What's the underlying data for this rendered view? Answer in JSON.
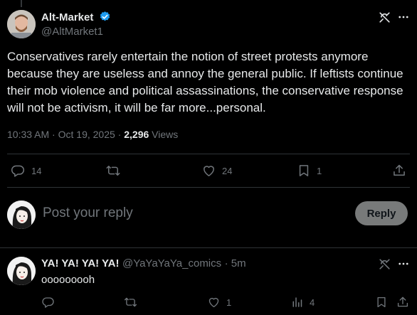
{
  "post": {
    "author_name": "Alt-Market",
    "author_handle": "@AltMarket1",
    "text": "Conservatives rarely entertain the notion of street protests anymore because they are useless and annoy the general public.  If leftists continue their mob violence and political assassinations, the conservative response will not be activism, it will be far more...personal.",
    "time": "10:33 AM",
    "sep1": "·",
    "date": "Oct 19, 2025",
    "sep2": "·",
    "views_count": "2,296",
    "views_label": "Views",
    "stats": {
      "replies": "14",
      "likes": "24",
      "bookmarks": "1"
    },
    "verified_color": "#1d9bf0"
  },
  "composer": {
    "placeholder": "Post your reply",
    "button_label": "Reply"
  },
  "reply": {
    "author_name": "YA! YA! YA! YA!",
    "author_handle": "@YaYaYaYa_comics",
    "time": "· 5m",
    "text": "ooooooooh",
    "stats": {
      "likes": "1",
      "views": "4"
    }
  },
  "icons": [
    "verified-badge-icon",
    "grok-icon",
    "more-icon",
    "reply-icon",
    "repost-icon",
    "like-icon",
    "bookmark-icon",
    "share-icon",
    "views-icon"
  ]
}
